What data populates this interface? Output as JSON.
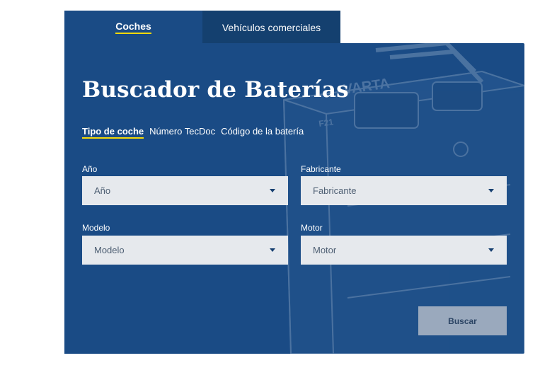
{
  "tabs": {
    "cars": "Coches",
    "commercial": "Vehículos comerciales"
  },
  "title": "Buscador de Baterías",
  "subtabs": {
    "car_type": "Tipo de coche",
    "tecdoc": "Número TecDoc",
    "battery_code": "Código de la batería"
  },
  "fields": {
    "year": {
      "label": "Año",
      "value": "Año"
    },
    "manufacturer": {
      "label": "Fabricante",
      "value": "Fabricante"
    },
    "model": {
      "label": "Modelo",
      "value": "Modelo"
    },
    "engine": {
      "label": "Motor",
      "value": "Motor"
    }
  },
  "search_button": "Buscar",
  "background_art": {
    "brand": "VARTA",
    "code": "F21"
  },
  "colors": {
    "panel": "#1a4b85",
    "tab_inactive": "#14406f",
    "accent_underline": "#f5d90a",
    "select_bg": "#e6e9ed",
    "button_bg": "#9aa9bd"
  }
}
